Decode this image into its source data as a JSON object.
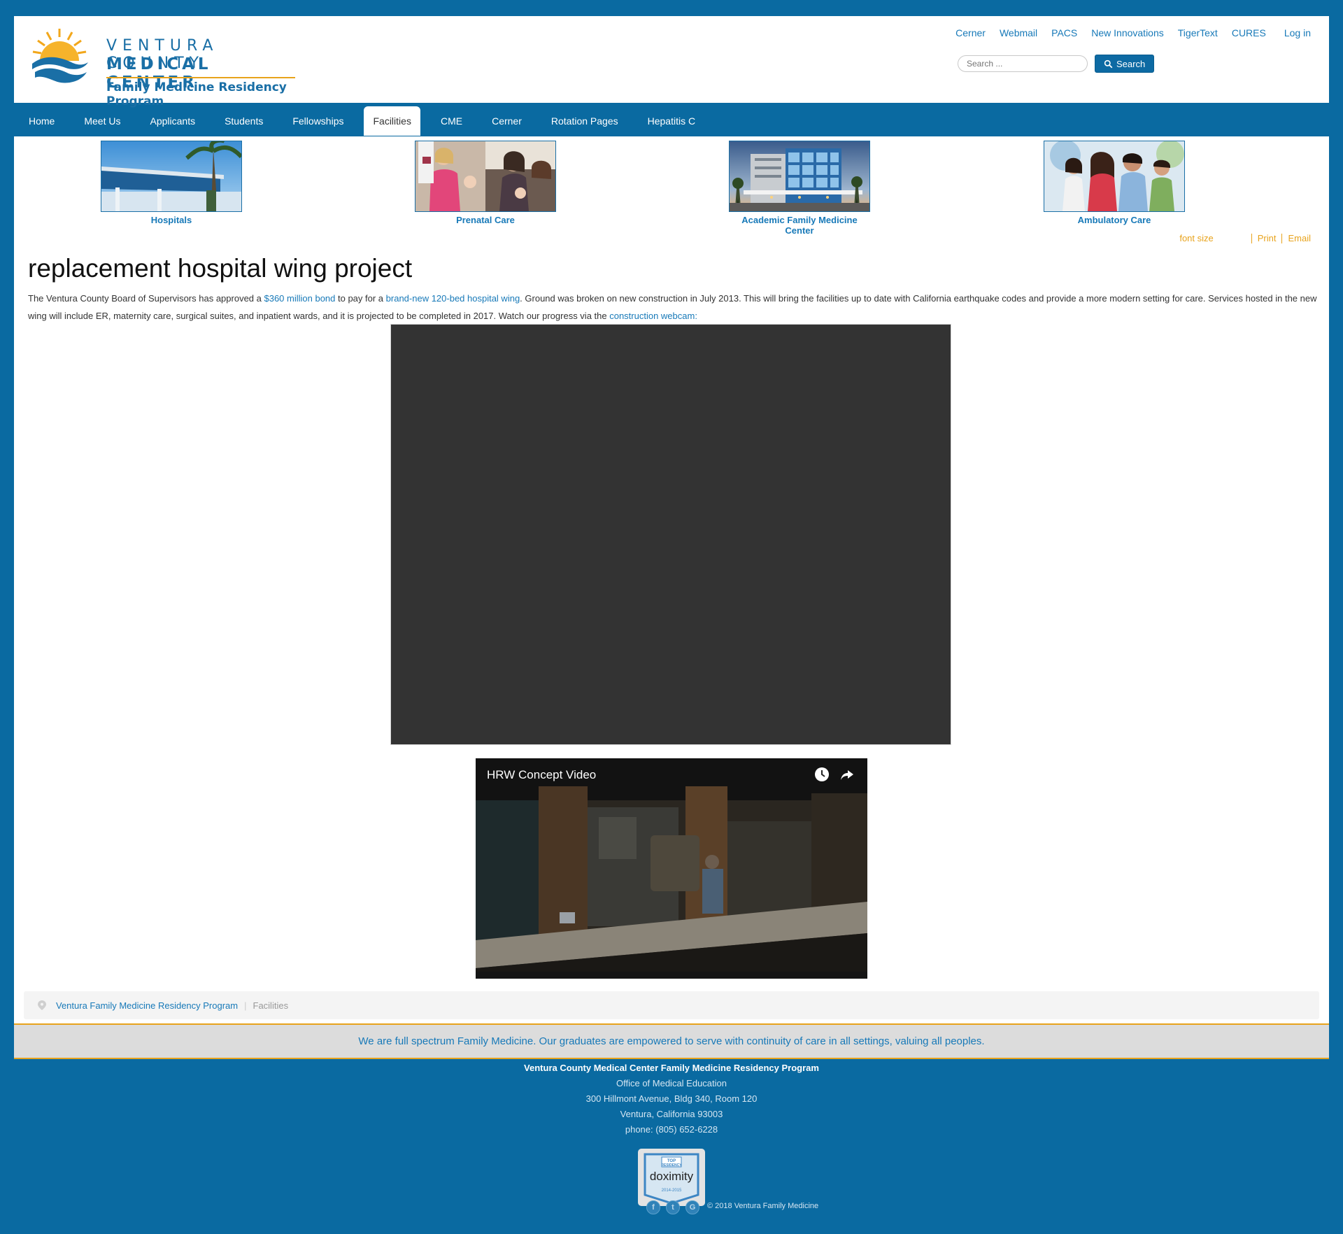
{
  "header": {
    "logo": {
      "line1": "VENTURA COUNTY",
      "line2": "MEDICAL CENTER",
      "line3": "Family Medicine Residency Program"
    },
    "util_links": [
      "Cerner",
      "Webmail",
      "PACS",
      "New Innovations",
      "TigerText",
      "CURES"
    ],
    "login": "Log in",
    "search": {
      "placeholder": "Search ...",
      "button": "Search"
    }
  },
  "nav": {
    "items": [
      "Home",
      "Meet Us",
      "Applicants",
      "Students",
      "Fellowships",
      "Facilities",
      "CME",
      "Cerner",
      "Rotation Pages",
      "Hepatitis C"
    ],
    "active": "Facilities"
  },
  "facilities": [
    {
      "label": "Hospitals"
    },
    {
      "label": "Prenatal Care"
    },
    {
      "label": "Academic Family Medicine Center"
    },
    {
      "label": "Ambulatory Care"
    }
  ],
  "tools": {
    "font_size": "font size",
    "print": "Print",
    "email": "Email"
  },
  "article": {
    "title": "replacement hospital wing project",
    "p1_a": "The Ventura County Board of Supervisors has approved a ",
    "link_bond": "$360 million bond",
    "p1_b": " to pay for a ",
    "link_wing": "brand-new 120-bed hospital wing",
    "p1_c": ". Ground was broken on new construction in July 2013. This will bring the facilities up to date with California earthquake codes and provide a more modern setting for care. Services hosted in the new wing will include ER, maternity care, surgical suites, and inpatient wards, and it is projected to be completed in 2017. Watch our progress via the ",
    "link_webcam": "construction webcam:",
    "video_title": "HRW Concept Video"
  },
  "breadcrumb": {
    "home": "Ventura Family Medicine Residency Program",
    "current": "Facilities"
  },
  "mission": "We are full spectrum Family Medicine. Our graduates are empowered to serve with continuity of care in all settings, valuing all peoples.",
  "footer": {
    "org": "Ventura County Medical Center Family Medicine Residency Program",
    "office": "Office of Medical Education",
    "address": "300 Hillmont Avenue, Bldg 340, Room 120",
    "city": "Ventura, California 93003",
    "phone": "phone: (805) 652-6228",
    "badge": {
      "top": "TOP",
      "residency": "RESIDENCY",
      "brand": "doximity",
      "years": "2014-2015"
    },
    "social": [
      "f",
      "t",
      "G"
    ],
    "copyright": "© 2018 Ventura Family Medicine"
  },
  "colors": {
    "brand_blue": "#0a6aa1",
    "link": "#1779b8",
    "accent_gold": "#e8a31c"
  }
}
